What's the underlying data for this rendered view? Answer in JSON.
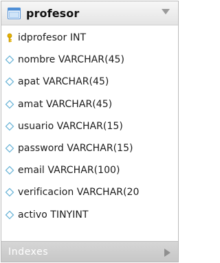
{
  "table": {
    "name": "profesor",
    "columns": [
      {
        "label": "idprofesor INT",
        "icon": "primary-key-icon"
      },
      {
        "label": "nombre VARCHAR(45)",
        "icon": "nullable-column-diamond-icon"
      },
      {
        "label": "apat VARCHAR(45)",
        "icon": "nullable-column-diamond-icon"
      },
      {
        "label": "amat VARCHAR(45)",
        "icon": "nullable-column-diamond-icon"
      },
      {
        "label": "usuario VARCHAR(15)",
        "icon": "nullable-column-diamond-icon"
      },
      {
        "label": "password VARCHAR(15)",
        "icon": "nullable-column-diamond-icon"
      },
      {
        "label": "email VARCHAR(100)",
        "icon": "nullable-column-diamond-icon"
      },
      {
        "label": "verificacion VARCHAR(20",
        "icon": "nullable-column-diamond-icon"
      },
      {
        "label": "activo TINYINT",
        "icon": "nullable-column-diamond-icon"
      }
    ],
    "footer_label": "Indexes"
  },
  "colors": {
    "header_bg": "#e9e9e9",
    "footer_bg": "#cccccc",
    "key_icon": "#e8b400",
    "diamond_icon": "#6fb6d8",
    "table_icon": "#4f8fd6"
  }
}
